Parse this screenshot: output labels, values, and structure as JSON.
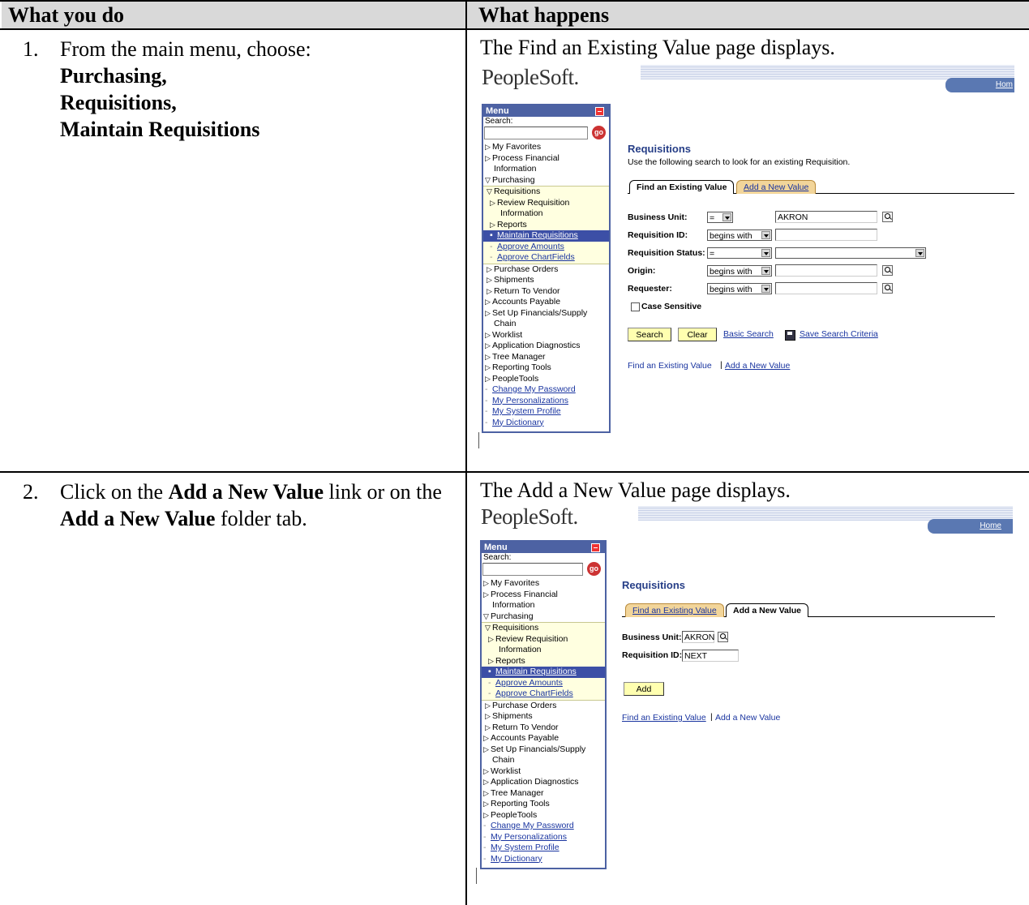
{
  "table": {
    "header_left": "What you do",
    "header_right": "What happens"
  },
  "steps": [
    {
      "number": "1.",
      "text_intro": "From the main menu, choose:",
      "bold_lines": [
        "Purchasing,",
        "Requisitions,",
        "Maintain Requisitions"
      ],
      "result": "The Find an Existing Value page displays."
    },
    {
      "number": "2.",
      "text_pre": "Click on the",
      "bold_a": "Add a New Value",
      "text_mid": "link or on the",
      "bold_b": "Add a New Value",
      "text_post": "folder tab.",
      "result": "The Add a New Value page displays."
    }
  ],
  "ps": {
    "logo": "PeopleSoft.",
    "home_link_1": "Hom",
    "home_link_2": "Home",
    "menu_title": "Menu",
    "search_label": "Search:",
    "go_label": "go",
    "menu_items": {
      "my_favorites": "My Favorites",
      "process_financial": "Process Financial",
      "information": "Information",
      "purchasing": "Purchasing",
      "requisitions": "Requisitions",
      "review_requisition": "Review Requisition",
      "reports": "Reports",
      "maintain_requisitions": "Maintain Requisitions",
      "approve_amounts": "Approve Amounts",
      "approve_chartfields": "Approve ChartFields",
      "purchase_orders": "Purchase Orders",
      "shipments": "Shipments",
      "return_to_vendor": "Return To Vendor",
      "accounts_payable": "Accounts Payable",
      "set_up_financials": "Set Up Financials/Supply",
      "chain": "Chain",
      "worklist": "Worklist",
      "application_diagnostics": "Application Diagnostics",
      "tree_manager": "Tree Manager",
      "reporting_tools": "Reporting Tools",
      "peopletools": "PeopleTools",
      "change_password": "Change My Password",
      "my_personalizations": "My Personalizations",
      "my_system_profile": "My System Profile",
      "my_dictionary": "My Dictionary"
    },
    "find_page": {
      "title": "Requisitions",
      "description": "Use the following search to look for an existing Requisition.",
      "tab_find": "Find an Existing Value",
      "tab_add": "Add a New Value",
      "fields": {
        "business_unit_label": "Business Unit:",
        "business_unit_op": "=",
        "business_unit_value": "AKRON",
        "requisition_id_label": "Requisition ID:",
        "requisition_id_op": "begins with",
        "requisition_status_label": "Requisition Status:",
        "requisition_status_op": "=",
        "origin_label": "Origin:",
        "origin_op": "begins with",
        "requester_label": "Requester:",
        "requester_op": "begins with",
        "case_sensitive_label": "Case Sensitive"
      },
      "search_button": "Search",
      "clear_button": "Clear",
      "basic_search_link": "Basic Search",
      "save_criteria_link": "Save Search Criteria",
      "bottom_find_link": "Find an Existing Value",
      "bottom_sep": "|",
      "bottom_add_link": "Add a New Value"
    },
    "add_page": {
      "title": "Requisitions",
      "tab_find": "Find an Existing Value",
      "tab_add": "Add a New Value",
      "business_unit_label": "Business Unit:",
      "business_unit_value": "AKRON",
      "requisition_id_label": "Requisition ID:",
      "requisition_id_value": "NEXT",
      "add_button": "Add",
      "bottom_find_link": "Find an Existing Value",
      "bottom_sep": "|",
      "bottom_add_text": "Add a New Value"
    }
  }
}
